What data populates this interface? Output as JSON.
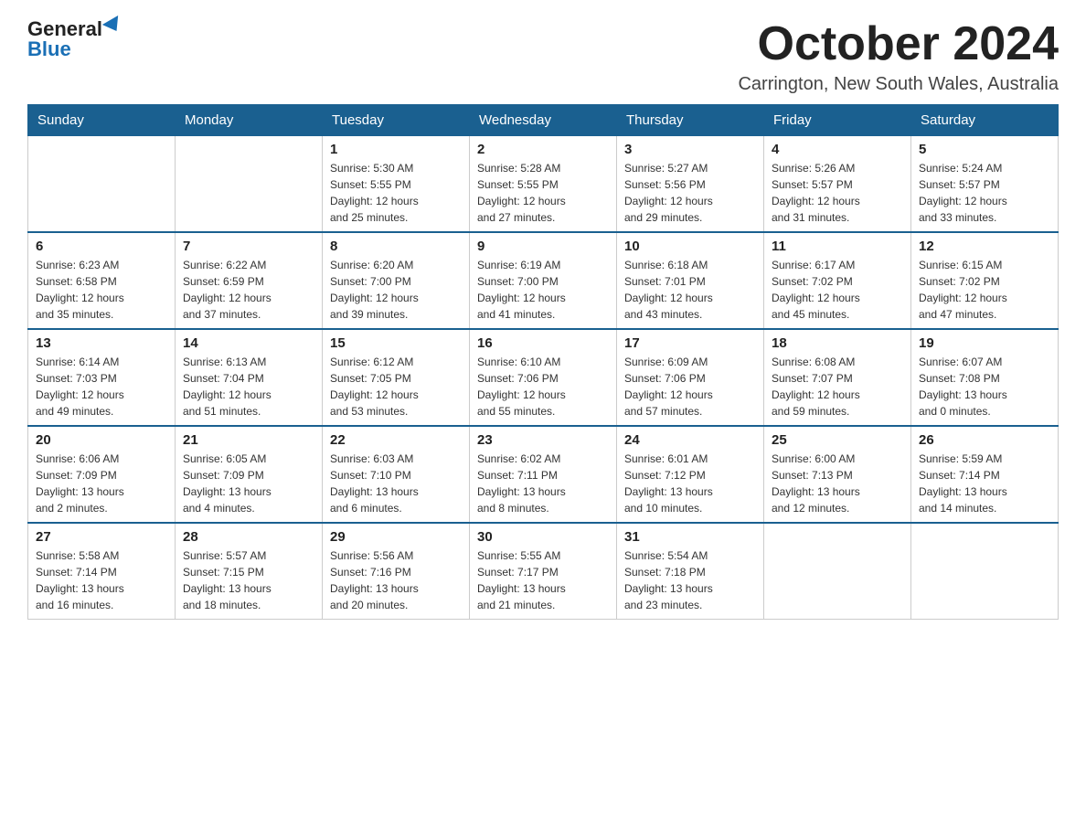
{
  "header": {
    "logo_text_general": "General",
    "logo_text_blue": "Blue",
    "month_title": "October 2024",
    "location": "Carrington, New South Wales, Australia"
  },
  "calendar": {
    "days_of_week": [
      "Sunday",
      "Monday",
      "Tuesday",
      "Wednesday",
      "Thursday",
      "Friday",
      "Saturday"
    ],
    "weeks": [
      [
        {
          "day": "",
          "info": ""
        },
        {
          "day": "",
          "info": ""
        },
        {
          "day": "1",
          "info": "Sunrise: 5:30 AM\nSunset: 5:55 PM\nDaylight: 12 hours\nand 25 minutes."
        },
        {
          "day": "2",
          "info": "Sunrise: 5:28 AM\nSunset: 5:55 PM\nDaylight: 12 hours\nand 27 minutes."
        },
        {
          "day": "3",
          "info": "Sunrise: 5:27 AM\nSunset: 5:56 PM\nDaylight: 12 hours\nand 29 minutes."
        },
        {
          "day": "4",
          "info": "Sunrise: 5:26 AM\nSunset: 5:57 PM\nDaylight: 12 hours\nand 31 minutes."
        },
        {
          "day": "5",
          "info": "Sunrise: 5:24 AM\nSunset: 5:57 PM\nDaylight: 12 hours\nand 33 minutes."
        }
      ],
      [
        {
          "day": "6",
          "info": "Sunrise: 6:23 AM\nSunset: 6:58 PM\nDaylight: 12 hours\nand 35 minutes."
        },
        {
          "day": "7",
          "info": "Sunrise: 6:22 AM\nSunset: 6:59 PM\nDaylight: 12 hours\nand 37 minutes."
        },
        {
          "day": "8",
          "info": "Sunrise: 6:20 AM\nSunset: 7:00 PM\nDaylight: 12 hours\nand 39 minutes."
        },
        {
          "day": "9",
          "info": "Sunrise: 6:19 AM\nSunset: 7:00 PM\nDaylight: 12 hours\nand 41 minutes."
        },
        {
          "day": "10",
          "info": "Sunrise: 6:18 AM\nSunset: 7:01 PM\nDaylight: 12 hours\nand 43 minutes."
        },
        {
          "day": "11",
          "info": "Sunrise: 6:17 AM\nSunset: 7:02 PM\nDaylight: 12 hours\nand 45 minutes."
        },
        {
          "day": "12",
          "info": "Sunrise: 6:15 AM\nSunset: 7:02 PM\nDaylight: 12 hours\nand 47 minutes."
        }
      ],
      [
        {
          "day": "13",
          "info": "Sunrise: 6:14 AM\nSunset: 7:03 PM\nDaylight: 12 hours\nand 49 minutes."
        },
        {
          "day": "14",
          "info": "Sunrise: 6:13 AM\nSunset: 7:04 PM\nDaylight: 12 hours\nand 51 minutes."
        },
        {
          "day": "15",
          "info": "Sunrise: 6:12 AM\nSunset: 7:05 PM\nDaylight: 12 hours\nand 53 minutes."
        },
        {
          "day": "16",
          "info": "Sunrise: 6:10 AM\nSunset: 7:06 PM\nDaylight: 12 hours\nand 55 minutes."
        },
        {
          "day": "17",
          "info": "Sunrise: 6:09 AM\nSunset: 7:06 PM\nDaylight: 12 hours\nand 57 minutes."
        },
        {
          "day": "18",
          "info": "Sunrise: 6:08 AM\nSunset: 7:07 PM\nDaylight: 12 hours\nand 59 minutes."
        },
        {
          "day": "19",
          "info": "Sunrise: 6:07 AM\nSunset: 7:08 PM\nDaylight: 13 hours\nand 0 minutes."
        }
      ],
      [
        {
          "day": "20",
          "info": "Sunrise: 6:06 AM\nSunset: 7:09 PM\nDaylight: 13 hours\nand 2 minutes."
        },
        {
          "day": "21",
          "info": "Sunrise: 6:05 AM\nSunset: 7:09 PM\nDaylight: 13 hours\nand 4 minutes."
        },
        {
          "day": "22",
          "info": "Sunrise: 6:03 AM\nSunset: 7:10 PM\nDaylight: 13 hours\nand 6 minutes."
        },
        {
          "day": "23",
          "info": "Sunrise: 6:02 AM\nSunset: 7:11 PM\nDaylight: 13 hours\nand 8 minutes."
        },
        {
          "day": "24",
          "info": "Sunrise: 6:01 AM\nSunset: 7:12 PM\nDaylight: 13 hours\nand 10 minutes."
        },
        {
          "day": "25",
          "info": "Sunrise: 6:00 AM\nSunset: 7:13 PM\nDaylight: 13 hours\nand 12 minutes."
        },
        {
          "day": "26",
          "info": "Sunrise: 5:59 AM\nSunset: 7:14 PM\nDaylight: 13 hours\nand 14 minutes."
        }
      ],
      [
        {
          "day": "27",
          "info": "Sunrise: 5:58 AM\nSunset: 7:14 PM\nDaylight: 13 hours\nand 16 minutes."
        },
        {
          "day": "28",
          "info": "Sunrise: 5:57 AM\nSunset: 7:15 PM\nDaylight: 13 hours\nand 18 minutes."
        },
        {
          "day": "29",
          "info": "Sunrise: 5:56 AM\nSunset: 7:16 PM\nDaylight: 13 hours\nand 20 minutes."
        },
        {
          "day": "30",
          "info": "Sunrise: 5:55 AM\nSunset: 7:17 PM\nDaylight: 13 hours\nand 21 minutes."
        },
        {
          "day": "31",
          "info": "Sunrise: 5:54 AM\nSunset: 7:18 PM\nDaylight: 13 hours\nand 23 minutes."
        },
        {
          "day": "",
          "info": ""
        },
        {
          "day": "",
          "info": ""
        }
      ]
    ]
  }
}
